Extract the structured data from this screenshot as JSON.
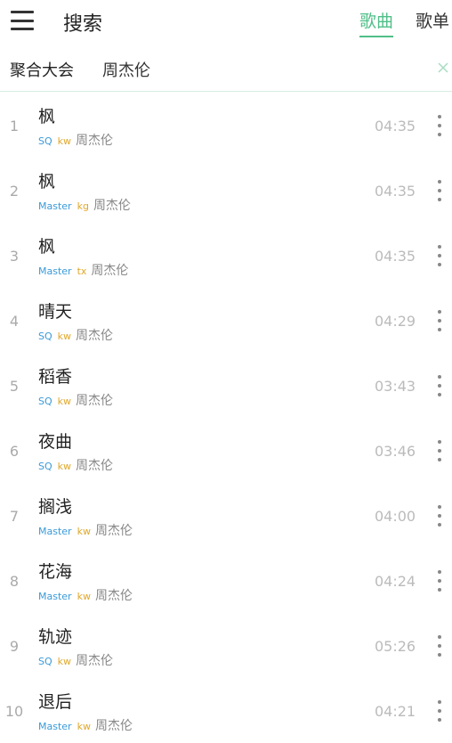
{
  "header": {
    "title": "搜索",
    "tabs": [
      {
        "label": "歌曲",
        "active": true
      },
      {
        "label": "歌单",
        "active": false
      }
    ],
    "accent_color": "#4fbf88"
  },
  "search": {
    "source": "聚合大会",
    "query": "周杰伦"
  },
  "icons": {
    "menu": "hamburger-menu-icon",
    "clear": "close-icon",
    "more": "vertical-ellipsis-icon"
  },
  "songs": [
    {
      "index": "1",
      "title": "枫",
      "quality": "SQ",
      "source": "kw",
      "artist": "周杰伦",
      "duration": "04:35"
    },
    {
      "index": "2",
      "title": "枫",
      "quality": "Master",
      "source": "kg",
      "artist": "周杰伦",
      "duration": "04:35"
    },
    {
      "index": "3",
      "title": "枫",
      "quality": "Master",
      "source": "tx",
      "artist": "周杰伦",
      "duration": "04:35"
    },
    {
      "index": "4",
      "title": "晴天",
      "quality": "SQ",
      "source": "kw",
      "artist": "周杰伦",
      "duration": "04:29"
    },
    {
      "index": "5",
      "title": "稻香",
      "quality": "SQ",
      "source": "kw",
      "artist": "周杰伦",
      "duration": "03:43"
    },
    {
      "index": "6",
      "title": "夜曲",
      "quality": "SQ",
      "source": "kw",
      "artist": "周杰伦",
      "duration": "03:46"
    },
    {
      "index": "7",
      "title": "搁浅",
      "quality": "Master",
      "source": "kw",
      "artist": "周杰伦",
      "duration": "04:00"
    },
    {
      "index": "8",
      "title": "花海",
      "quality": "Master",
      "source": "kw",
      "artist": "周杰伦",
      "duration": "04:24"
    },
    {
      "index": "9",
      "title": "轨迹",
      "quality": "SQ",
      "source": "kw",
      "artist": "周杰伦",
      "duration": "05:26"
    },
    {
      "index": "10",
      "title": "退后",
      "quality": "Master",
      "source": "kw",
      "artist": "周杰伦",
      "duration": "04:21"
    }
  ]
}
